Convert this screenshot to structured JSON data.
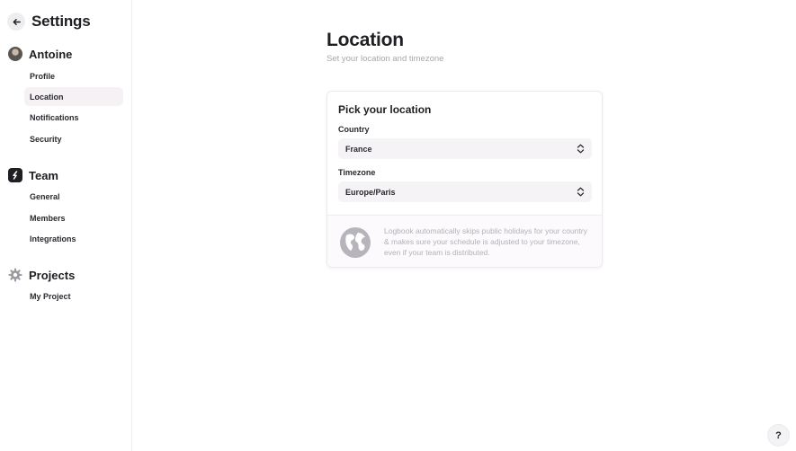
{
  "sidebar": {
    "title": "Settings",
    "back_icon": "arrow-left-icon",
    "user": {
      "name": "Antoine",
      "items": [
        {
          "label": "Profile",
          "active": false
        },
        {
          "label": "Location",
          "active": true
        },
        {
          "label": "Notifications",
          "active": false
        },
        {
          "label": "Security",
          "active": false
        }
      ]
    },
    "team": {
      "name": "Team",
      "icon": "team-logo-icon",
      "items": [
        {
          "label": "General"
        },
        {
          "label": "Members"
        },
        {
          "label": "Integrations"
        }
      ]
    },
    "projects": {
      "name": "Projects",
      "icon": "gear-icon",
      "items": [
        {
          "label": "My Project"
        }
      ]
    }
  },
  "main": {
    "title": "Location",
    "subtitle": "Set your location and timezone",
    "card": {
      "title": "Pick your location",
      "country_label": "Country",
      "country_value": "France",
      "timezone_label": "Timezone",
      "timezone_value": "Europe/Paris",
      "footer_icon": "globe-icon",
      "footer_text": "Logbook automatically skips public holidays for your country & makes sure your schedule is adjusted to your timezone, even if your team is distributed."
    }
  },
  "help": {
    "label": "?"
  },
  "colors": {
    "accent_bg": "#f5f1f4",
    "text": "#1f1f23",
    "muted": "#a7a7ae"
  }
}
